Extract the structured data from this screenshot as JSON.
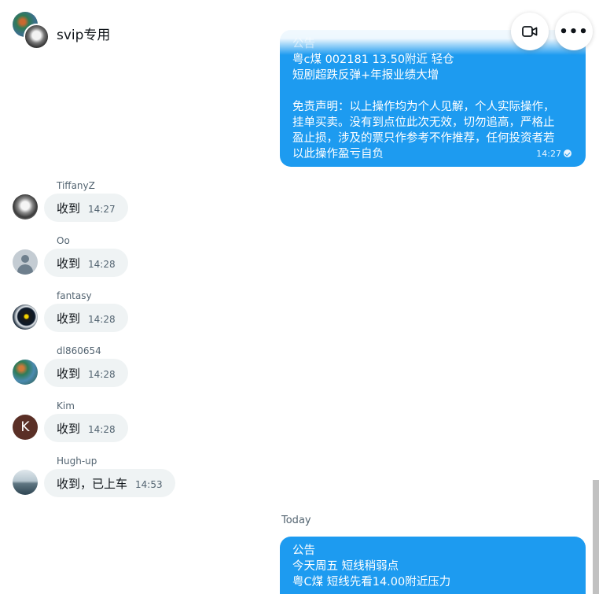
{
  "header": {
    "group_name": "svip专用",
    "video_icon": "video-camera-icon",
    "more_icon": "more-horizontal-icon",
    "more_glyph": "•••"
  },
  "announcement_1": {
    "lines": [
      "公告",
      "粤c煤 002181 13.50附近 轻仓",
      "短剧超跌反弹+年报业绩大增",
      "",
      "免责声明：以上操作均为个人见解，个人实际操作，",
      "挂单买卖。没有到点位此次无效，切勿追高，严格止",
      "盈止损，涉及的票只作参考不作推荐，任何投资者若",
      "以此操作盈亏自负"
    ],
    "time": "14:27"
  },
  "messages": [
    {
      "sender": "TiffanyZ",
      "text": "收到",
      "time": "14:27",
      "avatar": "dog-avatar"
    },
    {
      "sender": "Oo",
      "text": "收到",
      "time": "14:28",
      "avatar": "default-avatar"
    },
    {
      "sender": "fantasy",
      "text": "收到",
      "time": "14:28",
      "avatar": "eye-avatar"
    },
    {
      "sender": "dl860654",
      "text": "收到",
      "time": "14:28",
      "avatar": "map-avatar"
    },
    {
      "sender": "Kim",
      "text": "收到",
      "time": "14:28",
      "avatar": "letter-avatar",
      "initial": "K"
    },
    {
      "sender": "Hugh-up",
      "text": "收到，已上车",
      "time": "14:53",
      "avatar": "landscape-avatar"
    }
  ],
  "date_divider": "Today",
  "announcement_2": {
    "lines": [
      "公告",
      "今天周五 短线稍弱点",
      "粤C煤 短线先看14.00附近压力"
    ]
  },
  "colors": {
    "accent": "#1d9bf0",
    "incoming_bubble": "#eff3f4",
    "secondary_text": "#536471"
  }
}
